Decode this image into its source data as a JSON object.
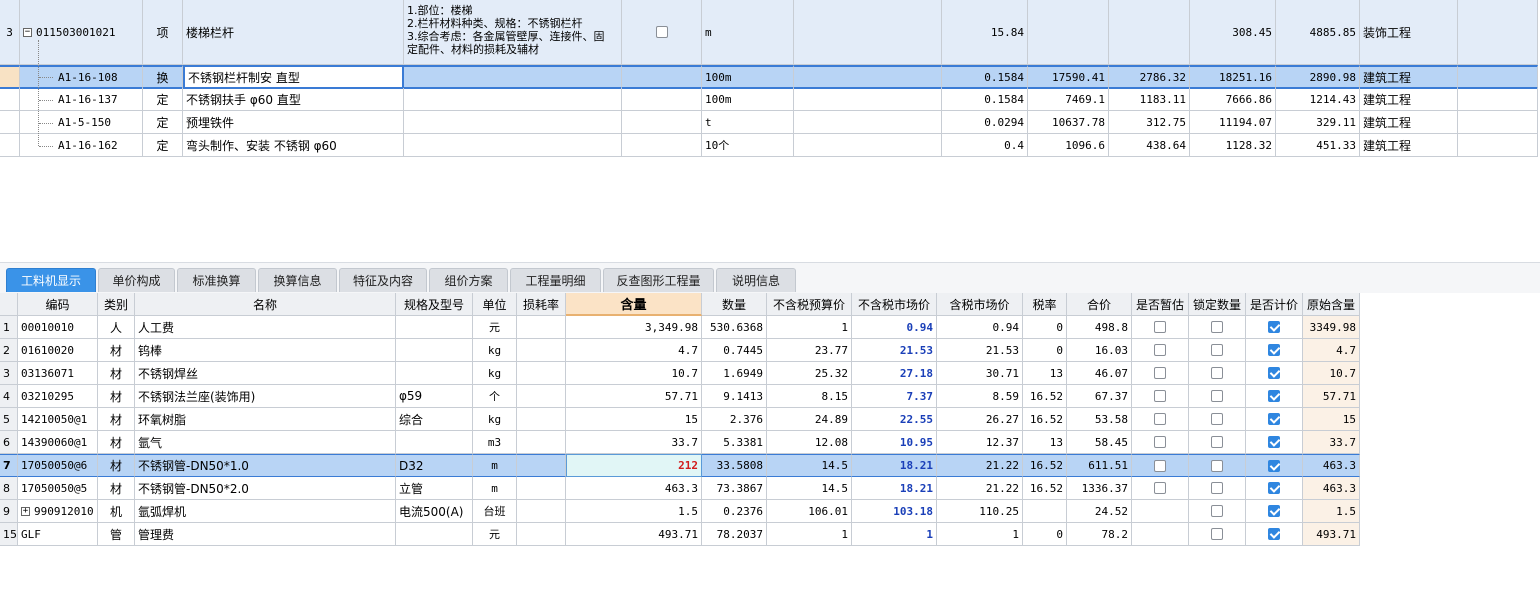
{
  "top": {
    "parent": {
      "index": "3",
      "code": "011503001021",
      "type": "项",
      "name": "楼梯栏杆",
      "desc": [
        "1.部位：楼梯",
        "2.栏杆材料种类、规格：不锈钢栏杆",
        "3.综合考虑：各金属管壁厚、连接件、固",
        "定配件、材料的损耗及辅材"
      ],
      "unit": "m",
      "quantity": "15.84",
      "col_a": "",
      "col_b": "",
      "price": "308.45",
      "total": "4885.85",
      "category": "装饰工程"
    },
    "rows": [
      {
        "code": "A1-16-108",
        "type": "换",
        "name": "不锈钢栏杆制安 直型",
        "unit": "100m",
        "quantity": "0.1584",
        "unit_price": "17590.41",
        "col_b": "2786.32",
        "price": "18251.16",
        "total": "2890.98",
        "category": "建筑工程"
      },
      {
        "code": "A1-16-137",
        "type": "定",
        "name": "不锈钢扶手 φ60 直型",
        "unit": "100m",
        "quantity": "0.1584",
        "unit_price": "7469.1",
        "col_b": "1183.11",
        "price": "7666.86",
        "total": "1214.43",
        "category": "建筑工程"
      },
      {
        "code": "A1-5-150",
        "type": "定",
        "name": "预埋铁件",
        "unit": "t",
        "quantity": "0.0294",
        "unit_price": "10637.78",
        "col_b": "312.75",
        "price": "11194.07",
        "total": "329.11",
        "category": "建筑工程"
      },
      {
        "code": "A1-16-162",
        "type": "定",
        "name": "弯头制作、安装 不锈钢 φ60",
        "unit": "10个",
        "quantity": "0.4",
        "unit_price": "1096.6",
        "col_b": "438.64",
        "price": "1128.32",
        "total": "451.33",
        "category": "建筑工程"
      }
    ]
  },
  "tabs": [
    "工料机显示",
    "单价构成",
    "标准换算",
    "换算信息",
    "特征及内容",
    "组价方案",
    "工程量明细",
    "反查图形工程量",
    "说明信息"
  ],
  "bottom": {
    "headers": [
      "编码",
      "类别",
      "名称",
      "规格及型号",
      "单位",
      "损耗率",
      "含量",
      "数量",
      "不含税预算价",
      "不含税市场价",
      "含税市场价",
      "税率",
      "合价",
      "是否暂估",
      "锁定数量",
      "是否计价",
      "原始含量"
    ],
    "rows": [
      {
        "idx": "1",
        "code": "00010010",
        "type": "人",
        "name": "人工费",
        "spec": "",
        "unit": "元",
        "loss": "",
        "qty_per": "3,349.98",
        "qty": "530.6368",
        "budget": "1",
        "market": "0.94",
        "market_tax": "0.94",
        "tax": "0",
        "sum": "498.8",
        "est": false,
        "lock": false,
        "priced": true,
        "orig": "3349.98"
      },
      {
        "idx": "2",
        "code": "01610020",
        "type": "材",
        "name": "钨棒",
        "spec": "",
        "unit": "kg",
        "loss": "",
        "qty_per": "4.7",
        "qty": "0.7445",
        "budget": "23.77",
        "market": "21.53",
        "market_tax": "21.53",
        "tax": "0",
        "sum": "16.03",
        "est": false,
        "lock": false,
        "priced": true,
        "orig": "4.7"
      },
      {
        "idx": "3",
        "code": "03136071",
        "type": "材",
        "name": "不锈钢焊丝",
        "spec": "",
        "unit": "kg",
        "loss": "",
        "qty_per": "10.7",
        "qty": "1.6949",
        "budget": "25.32",
        "market": "27.18",
        "market_tax": "30.71",
        "tax": "13",
        "sum": "46.07",
        "est": false,
        "lock": false,
        "priced": true,
        "orig": "10.7"
      },
      {
        "idx": "4",
        "code": "03210295",
        "type": "材",
        "name": "不锈钢法兰座(装饰用)",
        "spec": "φ59",
        "unit": "个",
        "loss": "",
        "qty_per": "57.71",
        "qty": "9.1413",
        "budget": "8.15",
        "market": "7.37",
        "market_tax": "8.59",
        "tax": "16.52",
        "sum": "67.37",
        "est": false,
        "lock": false,
        "priced": true,
        "orig": "57.71"
      },
      {
        "idx": "5",
        "code": "14210050@1",
        "type": "材",
        "name": "环氧树脂",
        "spec": "综合",
        "unit": "kg",
        "loss": "",
        "qty_per": "15",
        "qty": "2.376",
        "budget": "24.89",
        "market": "22.55",
        "market_tax": "26.27",
        "tax": "16.52",
        "sum": "53.58",
        "est": false,
        "lock": false,
        "priced": true,
        "orig": "15"
      },
      {
        "idx": "6",
        "code": "14390060@1",
        "type": "材",
        "name": "氩气",
        "spec": "",
        "unit": "m3",
        "loss": "",
        "qty_per": "33.7",
        "qty": "5.3381",
        "budget": "12.08",
        "market": "10.95",
        "market_tax": "12.37",
        "tax": "13",
        "sum": "58.45",
        "est": false,
        "lock": false,
        "priced": true,
        "orig": "33.7"
      },
      {
        "idx": "7",
        "code": "17050050@6",
        "type": "材",
        "name": "不锈钢管-DN50*1.0",
        "spec": "D32",
        "unit": "m",
        "loss": "",
        "qty_per": "212",
        "qty": "33.5808",
        "budget": "14.5",
        "market": "18.21",
        "market_tax": "21.22",
        "tax": "16.52",
        "sum": "611.51",
        "est": false,
        "lock": false,
        "priced": true,
        "orig": "463.3",
        "selected": true
      },
      {
        "idx": "8",
        "code": "17050050@5",
        "type": "材",
        "name": "不锈钢管-DN50*2.0",
        "spec": "立管",
        "unit": "m",
        "loss": "",
        "qty_per": "463.3",
        "qty": "73.3867",
        "budget": "14.5",
        "market": "18.21",
        "market_tax": "21.22",
        "tax": "16.52",
        "sum": "1336.37",
        "est": false,
        "lock": false,
        "priced": true,
        "orig": "463.3"
      },
      {
        "idx": "9",
        "code": "990912010",
        "type": "机",
        "name": "氩弧焊机",
        "spec": "电流500(A)",
        "unit": "台班",
        "loss": "",
        "qty_per": "1.5",
        "qty": "0.2376",
        "budget": "106.01",
        "market": "103.18",
        "market_tax": "110.25",
        "tax": "",
        "sum": "24.52",
        "est": null,
        "lock": false,
        "priced": true,
        "orig": "1.5",
        "expandable": true
      },
      {
        "idx": "15",
        "code": "GLF",
        "type": "管",
        "name": "管理费",
        "spec": "",
        "unit": "元",
        "loss": "",
        "qty_per": "493.71",
        "qty": "78.2037",
        "budget": "1",
        "market": "1",
        "market_tax": "1",
        "tax": "0",
        "sum": "78.2",
        "est": null,
        "lock": false,
        "priced": true,
        "orig": "493.71"
      }
    ]
  }
}
